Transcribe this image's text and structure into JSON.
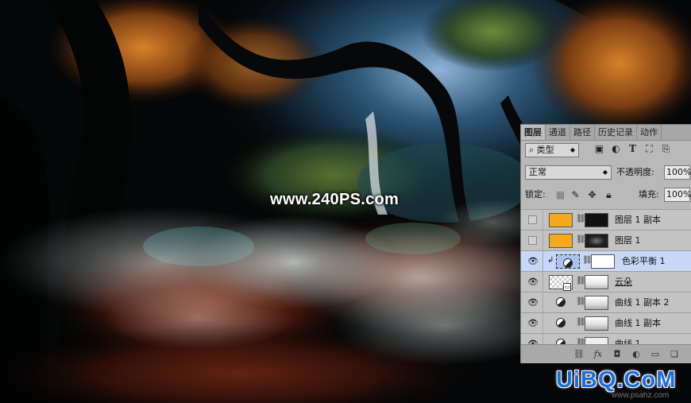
{
  "watermark": {
    "text": "www.240PS.com"
  },
  "brand": {
    "logo_text": "UiBQ.CoM",
    "sub_text": "www.psahz.com"
  },
  "panel": {
    "tabs": [
      {
        "label": "图层",
        "active": true
      },
      {
        "label": "通道",
        "active": false
      },
      {
        "label": "路径",
        "active": false
      },
      {
        "label": "历史记录",
        "active": false
      },
      {
        "label": "动作",
        "active": false
      }
    ],
    "filter": {
      "kind_label": "类型"
    },
    "blend_mode": "正常",
    "opacity_label": "不透明度:",
    "opacity_value": "100%",
    "lock_label": "锁定:",
    "fill_label": "填充:",
    "fill_value": "100%",
    "layers": [
      {
        "name": "图层 1 副本",
        "visible": false,
        "thumb": "orange",
        "mask": "dark",
        "active": false
      },
      {
        "name": "图层 1",
        "visible": false,
        "thumb": "orange",
        "mask": "dark",
        "active": false
      },
      {
        "name": "色彩平衡 1",
        "visible": true,
        "thumb": "adjustment",
        "mask": "white",
        "active": true
      },
      {
        "name": "云朵",
        "visible": true,
        "thumb": "checker",
        "mask": "light",
        "active": false
      },
      {
        "name": "曲线 1 副本 2",
        "visible": true,
        "thumb": "adjustment",
        "mask": "light",
        "active": false
      },
      {
        "name": "曲线 1 副本",
        "visible": true,
        "thumb": "adjustment",
        "mask": "light",
        "active": false
      },
      {
        "name": "曲线 1",
        "visible": true,
        "thumb": "adjustment",
        "mask": "light",
        "active": false
      }
    ]
  },
  "colors": {
    "orange_fill": "#f4a91a",
    "selection": "#c7d8f7",
    "panel_bg": "#b9b9b9"
  }
}
